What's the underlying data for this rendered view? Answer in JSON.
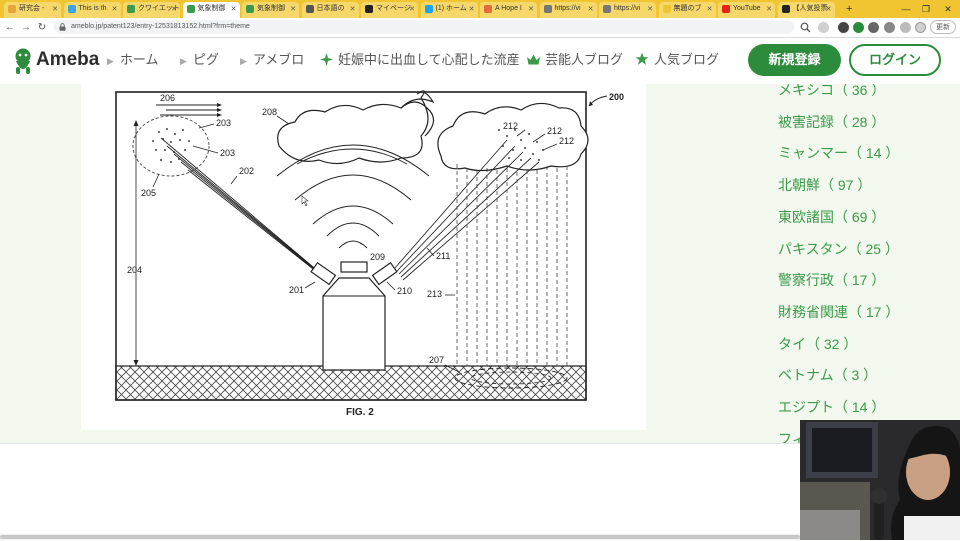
{
  "tabs": [
    {
      "title": "研究会 -",
      "favicon_color": "#e8a33c",
      "active": false
    },
    {
      "title": "This is th",
      "favicon_color": "#3ca3e8",
      "active": false
    },
    {
      "title": "クワイエット",
      "favicon_color": "#3c9a4a",
      "active": false
    },
    {
      "title": "気象制御",
      "favicon_color": "#3c9a4a",
      "active": true
    },
    {
      "title": "気象制御",
      "favicon_color": "#3c9a4a",
      "active": false
    },
    {
      "title": "日本語の",
      "favicon_color": "#555555",
      "active": false
    },
    {
      "title": "マイページ",
      "favicon_color": "#222222",
      "active": false
    },
    {
      "title": "(1) ホーム",
      "favicon_color": "#1da1f2",
      "active": false
    },
    {
      "title": "A Hope I",
      "favicon_color": "#e86a3c",
      "active": false
    },
    {
      "title": "https://vi",
      "favicon_color": "#777777",
      "active": false
    },
    {
      "title": "https://vi",
      "favicon_color": "#777777",
      "active": false
    },
    {
      "title": "無題のブ",
      "favicon_color": "#f0c430",
      "active": false
    },
    {
      "title": "YouTube",
      "favicon_color": "#e62117",
      "active": false
    },
    {
      "title": "【人気投票",
      "favicon_color": "#222222",
      "active": false
    }
  ],
  "new_tab_glyph": "+",
  "window_controls": {
    "minimize": "—",
    "maximize": "❐",
    "close": "✕"
  },
  "address": {
    "url": "ameblo.jp/patent123/entry-12531813152.html?frm=theme",
    "update_label": "更新"
  },
  "site": {
    "logo_text": "Ameba",
    "nav": [
      {
        "label": "ホーム",
        "marker": "arrow"
      },
      {
        "label": "ピグ",
        "marker": "arrow"
      },
      {
        "label": "アメブロ",
        "marker": "arrow"
      },
      {
        "label": "妊娠中に出血して心配した流産",
        "marker": "star"
      },
      {
        "label": "芸能人ブログ",
        "marker": "crown"
      },
      {
        "label": "人気ブログ",
        "marker": "star"
      }
    ],
    "register_label": "新規登録",
    "login_label": "ログイン"
  },
  "figure": {
    "caption": "FIG. 2",
    "ref_labels": [
      "200",
      "201",
      "202",
      "203",
      "203",
      "204",
      "205",
      "206",
      "207",
      "208",
      "209",
      "210",
      "211",
      "212",
      "212",
      "212",
      "213"
    ]
  },
  "categories": [
    {
      "name": "メキシコ",
      "count": 36
    },
    {
      "name": "被害記録",
      "count": 28
    },
    {
      "name": "ミャンマー",
      "count": 14
    },
    {
      "name": "北朝鮮",
      "count": 97
    },
    {
      "name": "東欧諸国",
      "count": 69
    },
    {
      "name": "パキスタン",
      "count": 25
    },
    {
      "name": "警察行政",
      "count": 17
    },
    {
      "name": "財務省関連",
      "count": 17
    },
    {
      "name": "タイ",
      "count": 32
    },
    {
      "name": "ベトナム",
      "count": 3
    },
    {
      "name": "エジプト",
      "count": 14
    },
    {
      "name": "フィ",
      "count": null
    }
  ],
  "colors": {
    "tab_strip": "#f1c431",
    "ameba_green": "#2d8c3c",
    "category_link": "#3c9a4a",
    "content_bg": "#f2f8ee"
  },
  "icons": [
    "back-icon",
    "forward-icon",
    "reload-icon",
    "lock-icon",
    "ameba-logo-icon",
    "search-icon",
    "extension-icon",
    "profile-icon",
    "menu-icon"
  ]
}
